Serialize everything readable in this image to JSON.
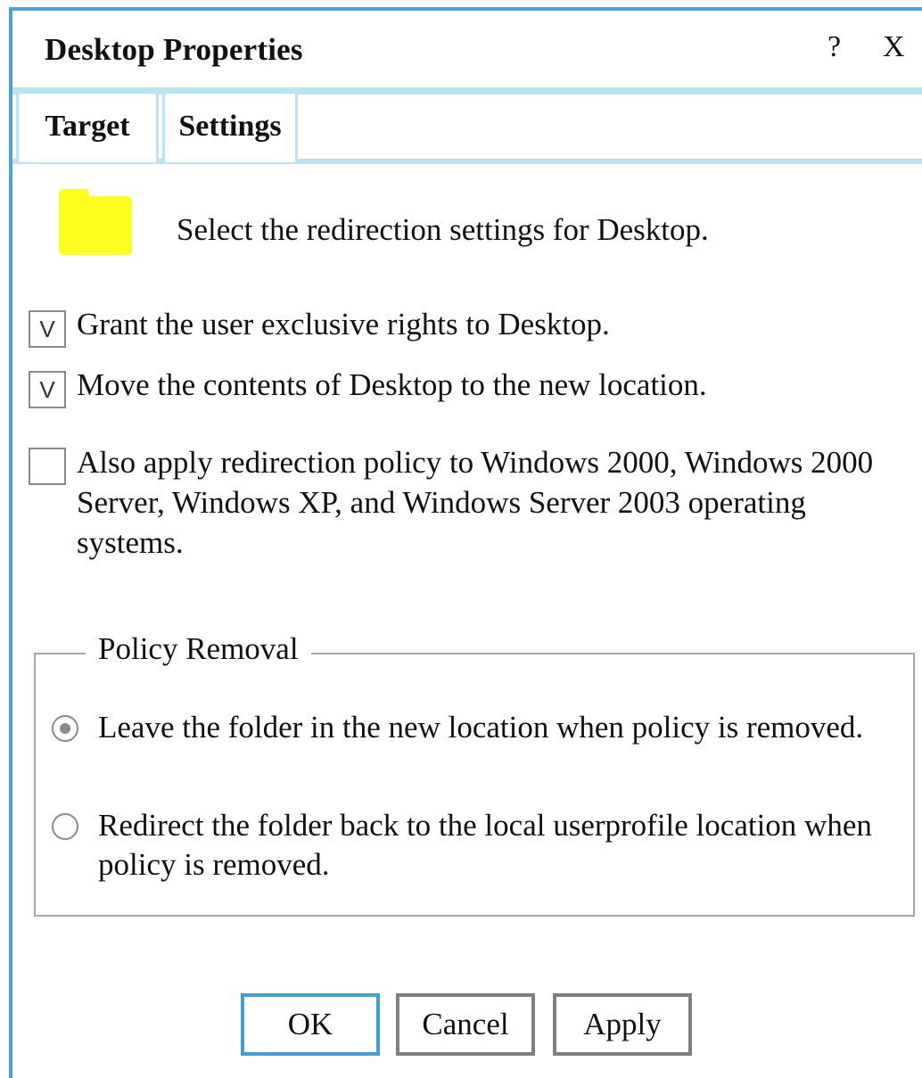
{
  "window": {
    "title": "Desktop Properties",
    "help_label": "?",
    "close_label": "X"
  },
  "tabs": [
    {
      "label": "Target"
    },
    {
      "label": "Settings",
      "selected": true
    }
  ],
  "intro": {
    "icon": "folder-icon",
    "text": "Select the redirection settings for Desktop."
  },
  "options": [
    {
      "label": "Grant the user exclusive rights to Desktop.",
      "checked": true,
      "mark": "V"
    },
    {
      "label": "Move the contents of Desktop to the new location.",
      "checked": true,
      "mark": "V"
    },
    {
      "label": "Also apply redirection policy to Windows 2000, Windows 2000 Server, Windows XP, and Windows Server 2003 operating systems.",
      "checked": false,
      "mark": ""
    }
  ],
  "policy_removal": {
    "legend": "Policy Removal",
    "options": [
      {
        "label": "Leave the folder in the new location when policy is removed.",
        "selected": true
      },
      {
        "label": "Redirect the folder back to the local userprofile location when policy is removed.",
        "selected": false
      }
    ]
  },
  "buttons": {
    "ok": "OK",
    "cancel": "Cancel",
    "apply": "Apply"
  },
  "colors": {
    "window_border": "#4aa3d8",
    "tab_border": "#bde3f2",
    "folder": "#ffff22",
    "ok_border": "#3ea0d4"
  }
}
